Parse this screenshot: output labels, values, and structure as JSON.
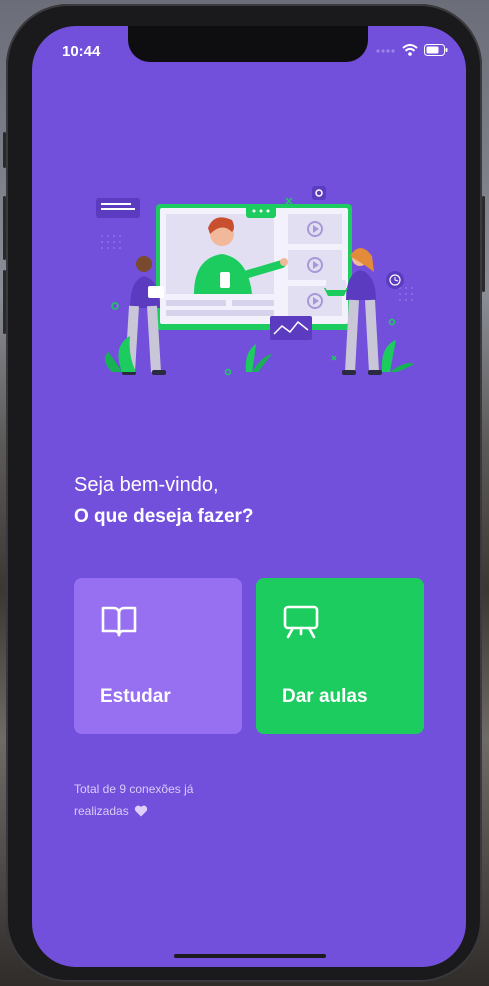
{
  "status_bar": {
    "time": "10:44",
    "icons": [
      "cellular-icon",
      "wifi-icon",
      "battery-icon"
    ]
  },
  "landing": {
    "greeting": "Seja bem-vindo,",
    "question": "O que deseja fazer?",
    "buttons": [
      {
        "label": "Estudar",
        "icon": "book-open-icon",
        "color": "#9670f0"
      },
      {
        "label": "Dar aulas",
        "icon": "presentation-screen-icon",
        "color": "#1ccc5f"
      }
    ],
    "connections_text": "Total de 9 conexões já realizadas",
    "connections_icon": "heart-icon"
  },
  "colors": {
    "background": "#7350dc",
    "primary_light": "#9670f0",
    "secondary": "#1ccc5f",
    "text": "#ffffff"
  }
}
